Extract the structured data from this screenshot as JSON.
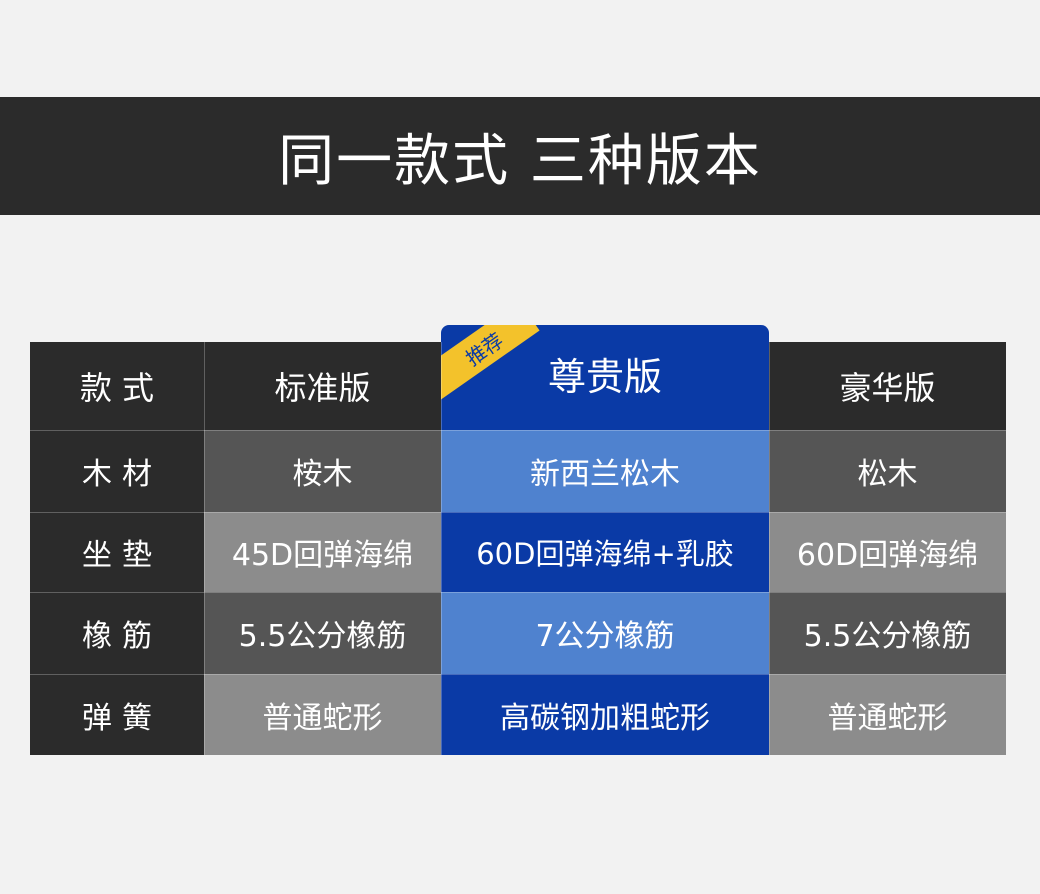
{
  "banner": {
    "title": "同一款式 三种版本"
  },
  "table": {
    "badge": "推荐",
    "header": {
      "label": "款式",
      "standard": "标准版",
      "premium": "尊贵版",
      "deluxe": "豪华版"
    },
    "rows": [
      {
        "label": "木材",
        "standard": "桉木",
        "premium": "新西兰松木",
        "deluxe": "松木"
      },
      {
        "label": "坐垫",
        "standard": "45D回弹海绵",
        "premium": "60D回弹海绵+乳胶",
        "deluxe": "60D回弹海绵"
      },
      {
        "label": "橡筋",
        "standard": "5.5公分橡筋",
        "premium": "7公分橡筋",
        "deluxe": "5.5公分橡筋"
      },
      {
        "label": "弹簧",
        "standard": "普通蛇形",
        "premium": "高碳钢加粗蛇形",
        "deluxe": "普通蛇形"
      }
    ]
  },
  "colors": {
    "dark": "#2b2b2b",
    "featured_blue": "#0a3aa6",
    "featured_light": "#4f82cf",
    "gray_dark": "#555555",
    "gray_light": "#8c8c8c",
    "badge_yellow": "#f3c22b"
  }
}
